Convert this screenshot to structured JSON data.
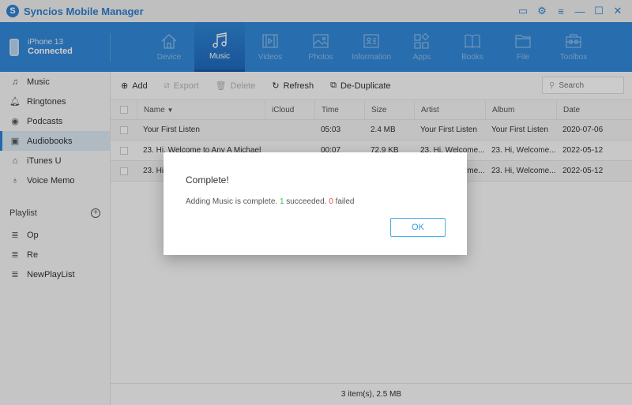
{
  "app": {
    "title": "Syncios Mobile Manager",
    "logo_letter": "S"
  },
  "window_controls": [
    {
      "name": "feedback",
      "icon": "feedback-icon",
      "glyph": "▭"
    },
    {
      "name": "settings",
      "icon": "gear-icon",
      "glyph": "⚙"
    },
    {
      "name": "menu",
      "icon": "menu-icon",
      "glyph": "≡"
    },
    {
      "name": "minimize",
      "icon": "minimize-icon",
      "glyph": "—"
    },
    {
      "name": "maximize",
      "icon": "maximize-icon",
      "glyph": "☐"
    },
    {
      "name": "close",
      "icon": "close-icon",
      "glyph": "✕"
    }
  ],
  "device": {
    "name": "iPhone 13",
    "status": "Connected"
  },
  "nav": {
    "active": "Music",
    "tabs": [
      {
        "label": "Device",
        "icon": "home-icon"
      },
      {
        "label": "Music",
        "icon": "music-note-icon"
      },
      {
        "label": "Videos",
        "icon": "video-icon"
      },
      {
        "label": "Photos",
        "icon": "photo-icon"
      },
      {
        "label": "Information",
        "icon": "contact-card-icon"
      },
      {
        "label": "Apps",
        "icon": "apps-icon"
      },
      {
        "label": "Books",
        "icon": "book-icon"
      },
      {
        "label": "File",
        "icon": "folder-icon"
      },
      {
        "label": "Toolbox",
        "icon": "toolbox-icon"
      }
    ]
  },
  "sidebar": {
    "active": "Audiobooks",
    "items": [
      {
        "label": "Music",
        "icon": "music-icon",
        "glyph": "♫"
      },
      {
        "label": "Ringtones",
        "icon": "bell-icon",
        "glyph": "🔔︎"
      },
      {
        "label": "Podcasts",
        "icon": "podcast-icon",
        "glyph": "◉"
      },
      {
        "label": "Audiobooks",
        "icon": "audiobook-icon",
        "glyph": "▣"
      },
      {
        "label": "iTunes U",
        "icon": "graduation-cap-icon",
        "glyph": "⌂"
      },
      {
        "label": "Voice Memo",
        "icon": "microphone-icon",
        "glyph": "♁"
      }
    ],
    "playlist_header": "Playlist",
    "playlists": [
      {
        "label": "Op",
        "icon": "playlist-icon",
        "glyph": "≣"
      },
      {
        "label": "Re",
        "icon": "playlist-icon",
        "glyph": "≣"
      },
      {
        "label": "NewPlayList",
        "icon": "playlist-icon",
        "glyph": "≣"
      }
    ]
  },
  "toolbar": {
    "add": "Add",
    "export": "Export",
    "delete": "Delete",
    "refresh": "Refresh",
    "deduplicate": "De-Duplicate",
    "search_placeholder": "Search"
  },
  "table": {
    "columns": [
      "Name",
      "iCloud",
      "Time",
      "Size",
      "Artist",
      "Album",
      "Date"
    ],
    "sort_column": "Name",
    "rows": [
      {
        "name": "Your First Listen",
        "icloud": "",
        "time": "05:03",
        "size": "2.4 MB",
        "artist": "Your First Listen",
        "album": "Your First Listen",
        "date": "2020-07-06"
      },
      {
        "name": "23. Hi, Welcome to Any A Michael",
        "icloud": "",
        "time": "00:07",
        "size": "72.9 KB",
        "artist": "23. Hi, Welcome...",
        "album": "23. Hi, Welcome...",
        "date": "2022-05-12"
      },
      {
        "name": "23. Hi,",
        "icloud": "",
        "time": "",
        "size": "",
        "artist": "23. Hi, Welcome...",
        "album": "23. Hi, Welcome...",
        "date": "2022-05-12"
      }
    ]
  },
  "status": {
    "summary": "3 item(s), 2.5 MB"
  },
  "dialog": {
    "title": "Complete!",
    "message_prefix": "Adding Music is complete. ",
    "succeeded_count": "1",
    "succeeded_label": " succeeded. ",
    "failed_count": "0",
    "failed_label": " failed",
    "ok_label": "OK"
  },
  "colors": {
    "accent": "#3389d9",
    "success": "#39c24a",
    "failure": "#e84c3d"
  }
}
